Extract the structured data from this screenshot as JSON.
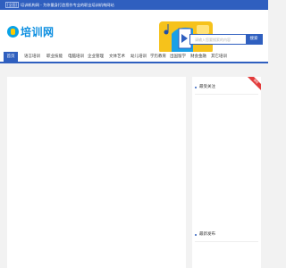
{
  "topbar": {
    "city": "[全国]",
    "message": "培训机构网 - 为你量身打造您作专业的职业培训机构网站",
    "background": "#2f5fbf"
  },
  "header": {
    "logo_text": "培训网",
    "search_placeholder": "请输入您要搜索的内容",
    "search_button": "搜索",
    "accent": "#2f5fbf"
  },
  "nav": {
    "items": [
      "首页",
      "语言培训",
      "职业技能",
      "电脑培训",
      "企业管理",
      "文体艺术",
      "幼儿培训",
      "学历教育",
      "出国留学",
      "财会金融",
      "其它培训"
    ],
    "active_index": 0
  },
  "sidebar": {
    "ribbon": "推荐",
    "title_1": "最受关注",
    "title_2": "最新发布"
  }
}
